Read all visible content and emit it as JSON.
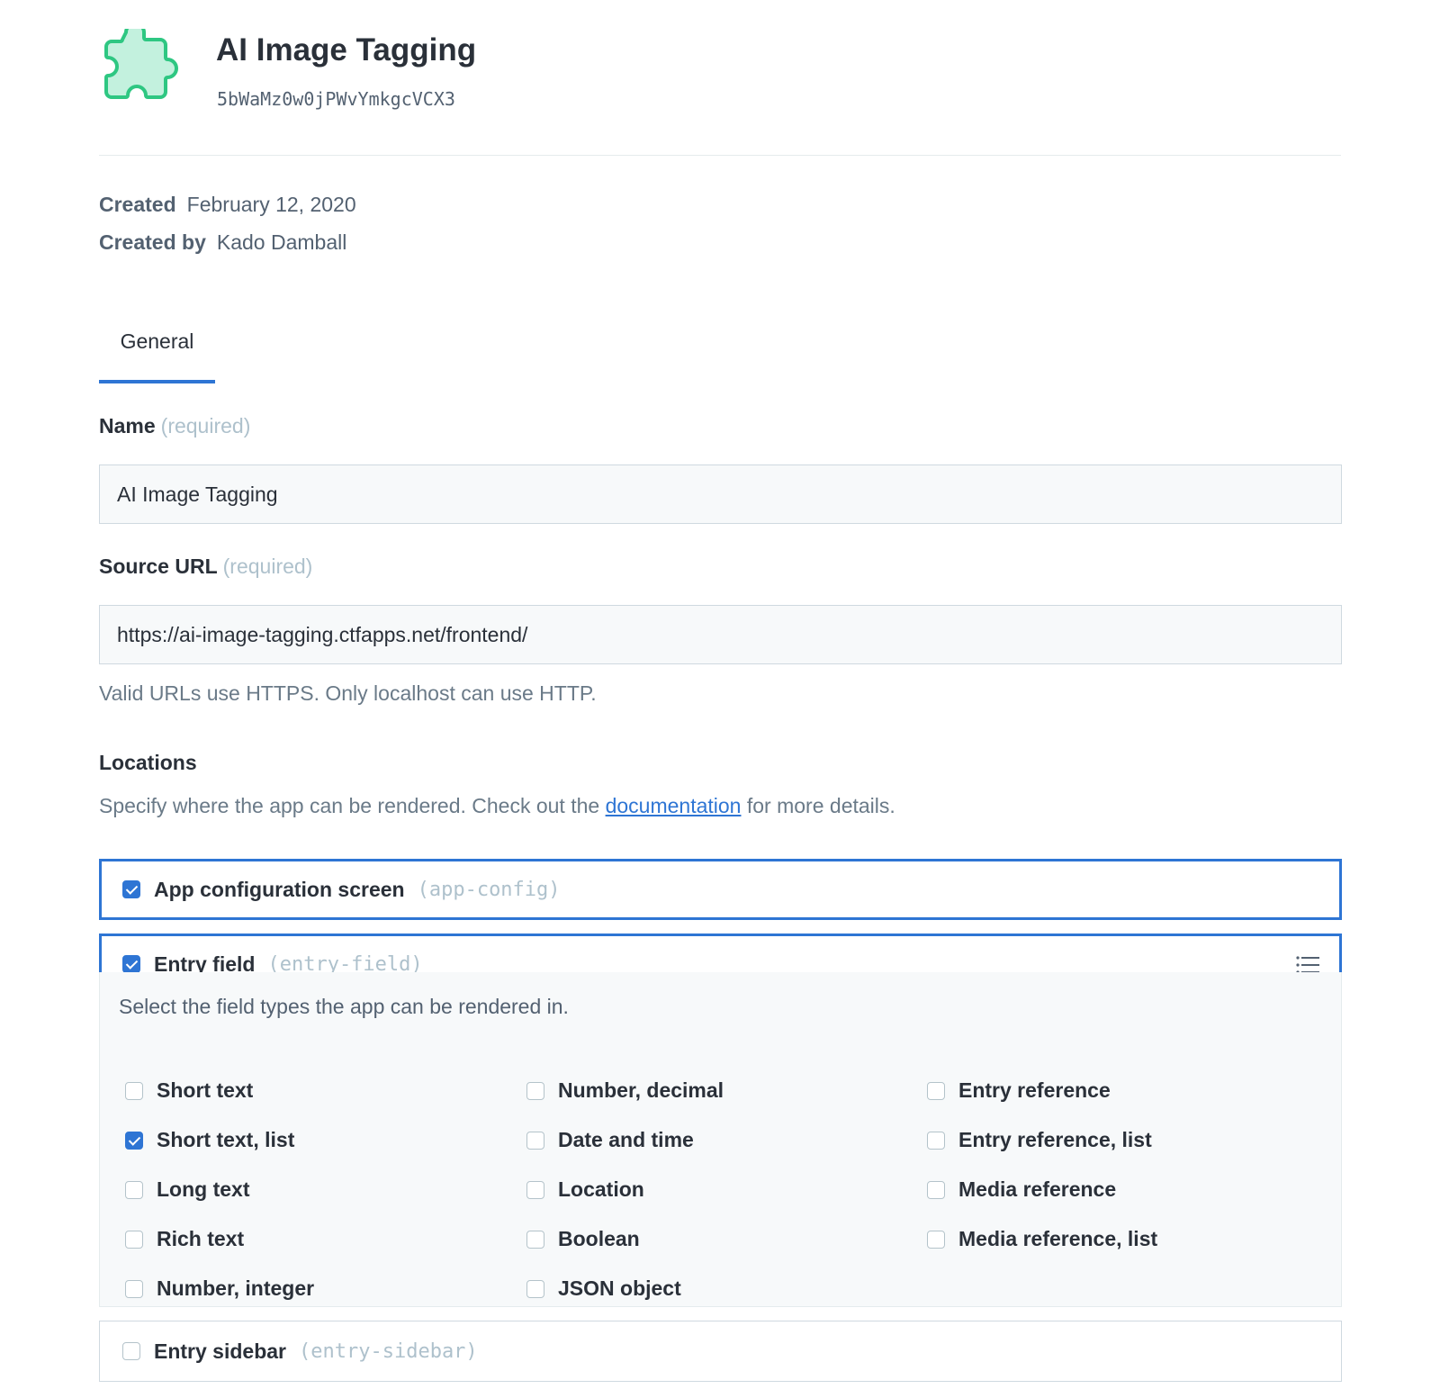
{
  "app": {
    "title": "AI Image Tagging",
    "id": "5bWaMz0w0jPWvYmkgcVCX3",
    "icon": "puzzle-piece-icon",
    "icon_color": "#2ec782",
    "icon_fill": "#c3f1de"
  },
  "meta": {
    "created_label": "Created",
    "created_value": "February 12, 2020",
    "created_by_label": "Created by",
    "created_by_value": "Kado Damball"
  },
  "tabs": [
    {
      "label": "General",
      "active": true
    }
  ],
  "form": {
    "name": {
      "label": "Name",
      "required": "(required)",
      "value": "AI Image Tagging"
    },
    "source_url": {
      "label": "Source URL",
      "required": "(required)",
      "value": "https://ai-image-tagging.ctfapps.net/frontend/",
      "help": "Valid URLs use HTTPS. Only localhost can use HTTP."
    },
    "locations": {
      "label": "Locations",
      "help_prefix": "Specify where the app can be rendered. Check out the ",
      "help_link": "documentation",
      "help_suffix": " for more details.",
      "items": [
        {
          "name": "App configuration screen",
          "code": "(app-config)",
          "checked": true
        },
        {
          "name": "Entry field",
          "code": "(entry-field)",
          "checked": true,
          "icon": "list-icon"
        },
        {
          "name": "Entry sidebar",
          "code": "(entry-sidebar)",
          "checked": false
        }
      ],
      "field_types": {
        "intro": "Select the field types the app can be rendered in.",
        "columns": [
          [
            {
              "label": "Short text",
              "checked": false
            },
            {
              "label": "Short text, list",
              "checked": true
            },
            {
              "label": "Long text",
              "checked": false
            },
            {
              "label": "Rich text",
              "checked": false
            },
            {
              "label": "Number, integer",
              "checked": false
            }
          ],
          [
            {
              "label": "Number, decimal",
              "checked": false
            },
            {
              "label": "Date and time",
              "checked": false
            },
            {
              "label": "Location",
              "checked": false
            },
            {
              "label": "Boolean",
              "checked": false
            },
            {
              "label": "JSON object",
              "checked": false
            }
          ],
          [
            {
              "label": "Entry reference",
              "checked": false
            },
            {
              "label": "Entry reference, list",
              "checked": false
            },
            {
              "label": "Media reference",
              "checked": false
            },
            {
              "label": "Media reference, list",
              "checked": false
            }
          ]
        ]
      }
    }
  },
  "colors": {
    "accent": "#2e75d4",
    "text": "#2a3039",
    "muted": "#536171",
    "placeholder": "#aec1cc"
  }
}
